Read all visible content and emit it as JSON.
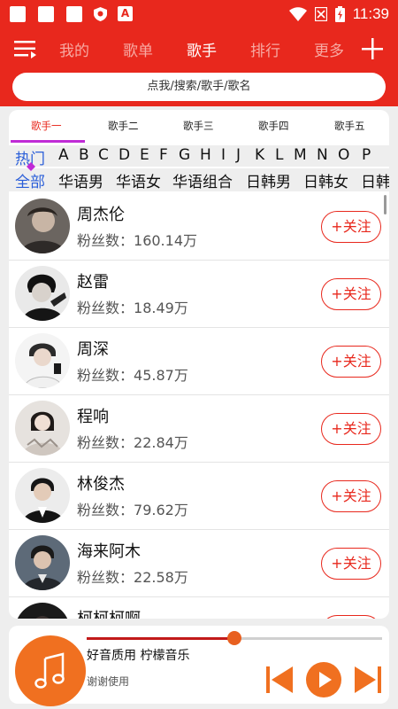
{
  "status_bar": {
    "time": "11:39",
    "badge_letter": "A"
  },
  "nav": {
    "tabs": [
      "我的",
      "歌单",
      "歌手",
      "排行",
      "更多"
    ],
    "active_tab": "歌手"
  },
  "search": {
    "placeholder": "点我/搜索/歌手/歌名"
  },
  "sub_tabs": [
    "歌手一",
    "歌手二",
    "歌手三",
    "歌手四",
    "歌手五"
  ],
  "alphabet": [
    "热门",
    "A",
    "B",
    "C",
    "D",
    "E",
    "F",
    "G",
    "H",
    "I",
    "J",
    "K",
    "L",
    "M",
    "N",
    "O",
    "P"
  ],
  "categories": [
    "全部",
    "华语男",
    "华语女",
    "华语组合",
    "日韩男",
    "日韩女",
    "日韩"
  ],
  "fans_label": "粉丝数：",
  "follow_label": "+关注",
  "singers": [
    {
      "name": "周杰伦",
      "fans": "160.14万"
    },
    {
      "name": "赵雷",
      "fans": "18.49万"
    },
    {
      "name": "周深",
      "fans": "45.87万"
    },
    {
      "name": "程响",
      "fans": "22.84万"
    },
    {
      "name": "林俊杰",
      "fans": "79.62万"
    },
    {
      "name": "海来阿木",
      "fans": "22.58万"
    },
    {
      "name": "柯柯柯啊",
      "fans": ""
    }
  ],
  "player": {
    "title": "好音质用 柠檬音乐",
    "subtitle": "谢谢使用",
    "progress": 0.5
  },
  "colors": {
    "brand": "#e8281d",
    "accent": "#f07020",
    "selected": "#2b5fd9"
  }
}
